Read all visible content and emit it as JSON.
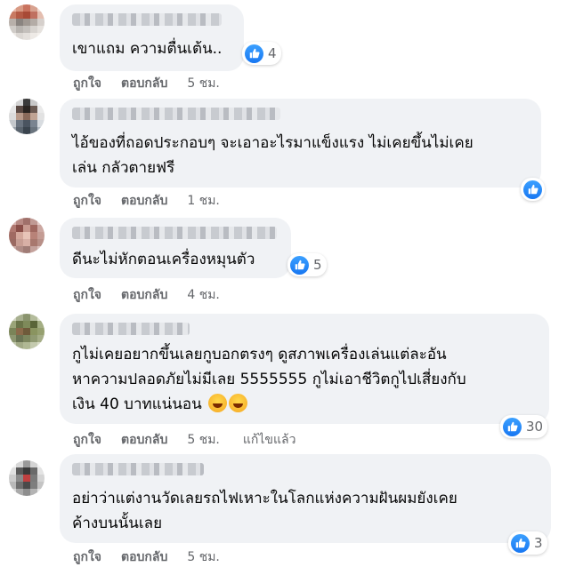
{
  "comments": [
    {
      "text": "เขาแถม ความตื่นเต้น..",
      "likes": "4",
      "like_label": "ถูกใจ",
      "reply_label": "ตอบกลับ",
      "time": "5 ชม."
    },
    {
      "text": "ไอ้ของที่ถอดประกอบๆ จะเอาอะไรมาแข็งแรง ไม่เคยขึ้นไม่เคย\nเล่น กลัวตายฟรี",
      "likes": "",
      "like_label": "ถูกใจ",
      "reply_label": "ตอบกลับ",
      "time": "1 ชม."
    },
    {
      "text": "ดีนะไม่หักตอนเครื่องหมุนตัว",
      "likes": "5",
      "like_label": "ถูกใจ",
      "reply_label": "ตอบกลับ",
      "time": "4 ชม."
    },
    {
      "text_line1": "กูไม่เคยอยากขึ้นเลยกูบอกตรงๆ ดูสภาพเครื่องเล่นแต่ละอัน",
      "text_line2": "หาความปลอดภัยไม่มีเลย 5555555 กูไม่เอาชีวิตกูไปเสี่ยงกับ",
      "text_line3": "เงิน 40 บาทแน่นอน",
      "likes": "30",
      "like_label": "ถูกใจ",
      "reply_label": "ตอบกลับ",
      "time": "5 ชม.",
      "edited_label": "แก้ไขแล้ว"
    },
    {
      "text": "อย่าว่าแต่งานวัดเลยรถไฟเหาะในโลกแห่งความฝันผมยังเคย\nค้างบนนั้นเลย",
      "likes": "3",
      "like_label": "ถูกใจ",
      "reply_label": "ตอบกลับ",
      "time": "5 ชม."
    }
  ],
  "colors": {
    "bubble": "#f0f2f5",
    "like_blue": "#1877f2",
    "meta_gray": "#65676b"
  }
}
